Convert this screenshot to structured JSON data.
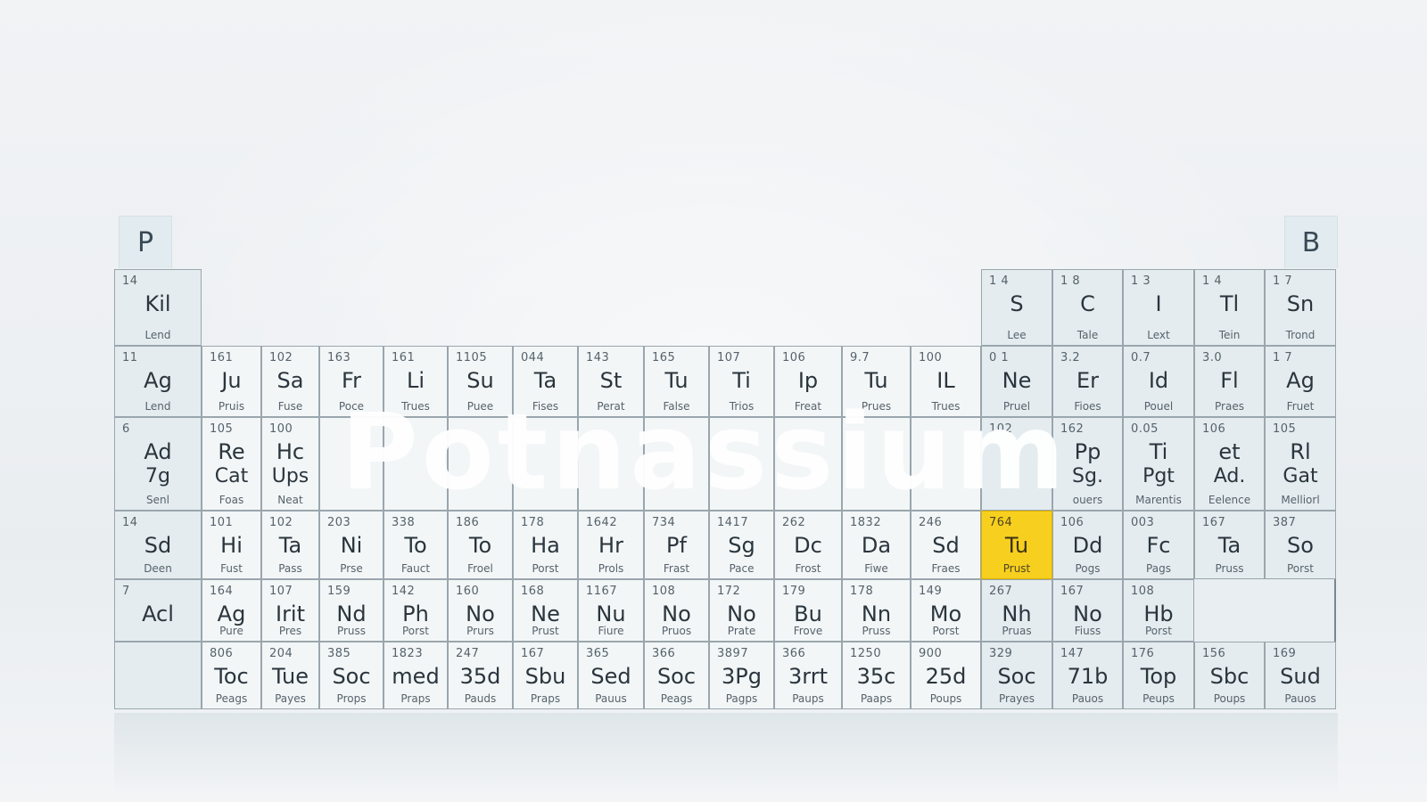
{
  "tabs": {
    "left": "P",
    "right": "B"
  },
  "overlay_text": "Potnassium",
  "highlight_color": "#f7cf1f",
  "cells": [
    {
      "n": "14",
      "s": "Kil",
      "l": "Lend",
      "c": 0,
      "r": 0
    },
    {
      "n": "1 4",
      "s": "S",
      "l": "Lee",
      "c": 13,
      "r": 0
    },
    {
      "n": "1 8",
      "s": "C",
      "l": "Tale",
      "c": 14,
      "r": 0
    },
    {
      "n": "1 3",
      "s": "I",
      "l": "Lext",
      "c": 15,
      "r": 0
    },
    {
      "n": "1 4",
      "s": "Tl",
      "l": "Tein",
      "c": 16,
      "r": 0
    },
    {
      "n": "1 7",
      "s": "Sn",
      "l": "Trond",
      "c": 17,
      "r": 0
    },
    {
      "n": "11",
      "s": "Ag",
      "l": "Lend",
      "c": 0,
      "r": 1
    },
    {
      "n": "161",
      "s": "Ju",
      "l": "Pruis",
      "c": 1,
      "r": 1
    },
    {
      "n": "102",
      "s": "Sa",
      "l": "Fuse",
      "c": 2,
      "r": 1
    },
    {
      "n": "163",
      "s": "Fr",
      "l": "Poce",
      "c": 3,
      "r": 1
    },
    {
      "n": "161",
      "s": "Li",
      "l": "Trues",
      "c": 4,
      "r": 1
    },
    {
      "n": "1105",
      "s": "Su",
      "l": "Puee",
      "c": 5,
      "r": 1
    },
    {
      "n": "044",
      "s": "Ta",
      "l": "Fises",
      "c": 6,
      "r": 1
    },
    {
      "n": "143",
      "s": "St",
      "l": "Perat",
      "c": 7,
      "r": 1
    },
    {
      "n": "165",
      "s": "Tu",
      "l": "False",
      "c": 8,
      "r": 1
    },
    {
      "n": "107",
      "s": "Ti",
      "l": "Trios",
      "c": 9,
      "r": 1
    },
    {
      "n": "106",
      "s": "Ip",
      "l": "Freat",
      "c": 10,
      "r": 1
    },
    {
      "n": "9.7",
      "s": "Tu",
      "l": "Prues",
      "c": 11,
      "r": 1
    },
    {
      "n": "100",
      "s": "IL",
      "l": "Trues",
      "c": 12,
      "r": 1
    },
    {
      "n": "0 1",
      "s": "Ne",
      "l": "Pruel",
      "c": 13,
      "r": 1
    },
    {
      "n": "3.2",
      "s": "Er",
      "l": "Fioes",
      "c": 14,
      "r": 1
    },
    {
      "n": "0.7",
      "s": "Id",
      "l": "Pouel",
      "c": 15,
      "r": 1
    },
    {
      "n": "3.0",
      "s": "Fl",
      "l": "Praes",
      "c": 16,
      "r": 1
    },
    {
      "n": "1 7",
      "s": "Ag",
      "l": "Fruet",
      "c": 17,
      "r": 1
    },
    {
      "n": "6",
      "s": "Ad",
      "s2": "7g",
      "l": "Senl",
      "c": 0,
      "r": 2
    },
    {
      "n": "105",
      "s": "Re",
      "s2": "Cat",
      "l": "Foas",
      "c": 1,
      "r": 2
    },
    {
      "n": "100",
      "s": "Hc",
      "s2": "Ups",
      "l": "Neat",
      "c": 2,
      "r": 2
    },
    {
      "n": "",
      "s": "",
      "l": "",
      "c": 3,
      "r": 2
    },
    {
      "n": "",
      "s": "",
      "l": "",
      "c": 4,
      "r": 2
    },
    {
      "n": "",
      "s": "",
      "l": "",
      "c": 5,
      "r": 2
    },
    {
      "n": "",
      "s": "",
      "l": "",
      "c": 6,
      "r": 2
    },
    {
      "n": "",
      "s": "",
      "l": "",
      "c": 7,
      "r": 2
    },
    {
      "n": "",
      "s": "",
      "l": "",
      "c": 8,
      "r": 2
    },
    {
      "n": "",
      "s": "",
      "l": "",
      "c": 9,
      "r": 2
    },
    {
      "n": "",
      "s": "",
      "l": "",
      "c": 10,
      "r": 2
    },
    {
      "n": "",
      "s": "",
      "l": "",
      "c": 11,
      "r": 2
    },
    {
      "n": "",
      "s": "",
      "l": "",
      "c": 12,
      "r": 2
    },
    {
      "n": "102",
      "s": "",
      "l": "",
      "c": 13,
      "r": 2
    },
    {
      "n": "162",
      "s": "Pp",
      "s2": "Sg.",
      "l": "ouers",
      "c": 14,
      "r": 2
    },
    {
      "n": "0.05",
      "s": "Ti",
      "s2": "Pgt",
      "l": "Marentis",
      "c": 15,
      "r": 2
    },
    {
      "n": "106",
      "s": "et",
      "s2": "Ad.",
      "l": "Eelence",
      "c": 16,
      "r": 2
    },
    {
      "n": "105",
      "s": "Rl",
      "s2": "Gat",
      "l": "Melliorl",
      "c": 17,
      "r": 2
    },
    {
      "n": "14",
      "s": "Sd",
      "l": "Deen",
      "c": 0,
      "r": 3
    },
    {
      "n": "101",
      "s": "Hi",
      "l": "Fust",
      "c": 1,
      "r": 3
    },
    {
      "n": "102",
      "s": "Ta",
      "l": "Pass",
      "c": 2,
      "r": 3
    },
    {
      "n": "203",
      "s": "Ni",
      "l": "Prse",
      "c": 3,
      "r": 3
    },
    {
      "n": "338",
      "s": "To",
      "l": "Fauct",
      "c": 4,
      "r": 3
    },
    {
      "n": "186",
      "s": "To",
      "l": "Froel",
      "c": 5,
      "r": 3
    },
    {
      "n": "178",
      "s": "Ha",
      "l": "Porst",
      "c": 6,
      "r": 3
    },
    {
      "n": "1642",
      "s": "Hr",
      "l": "Prols",
      "c": 7,
      "r": 3
    },
    {
      "n": "734",
      "s": "Pf",
      "l": "Frast",
      "c": 8,
      "r": 3
    },
    {
      "n": "1417",
      "s": "Sg",
      "l": "Pace",
      "c": 9,
      "r": 3
    },
    {
      "n": "262",
      "s": "Dc",
      "l": "Frost",
      "c": 10,
      "r": 3
    },
    {
      "n": "1832",
      "s": "Da",
      "l": "Fiwe",
      "c": 11,
      "r": 3
    },
    {
      "n": "246",
      "s": "Sd",
      "l": "Fraes",
      "c": 12,
      "r": 3
    },
    {
      "n": "764",
      "s": "Tu",
      "l": "Prust",
      "c": 13,
      "r": 3,
      "hl": true
    },
    {
      "n": "106",
      "s": "Dd",
      "l": "Pogs",
      "c": 14,
      "r": 3
    },
    {
      "n": "003",
      "s": "Fc",
      "l": "Pags",
      "c": 15,
      "r": 3
    },
    {
      "n": "167",
      "s": "Ta",
      "l": "Pruss",
      "c": 16,
      "r": 3
    },
    {
      "n": "387",
      "s": "So",
      "l": "Porst",
      "c": 17,
      "r": 3
    },
    {
      "n": "7",
      "s": "Acl",
      "l": "",
      "c": 0,
      "r": 4
    },
    {
      "n": "164",
      "s": "Ag",
      "l": "Pure",
      "c": 1,
      "r": 4
    },
    {
      "n": "107",
      "s": "Irit",
      "l": "Pres",
      "c": 2,
      "r": 4
    },
    {
      "n": "159",
      "s": "Nd",
      "l": "Pruss",
      "c": 3,
      "r": 4
    },
    {
      "n": "142",
      "s": "Ph",
      "l": "Porst",
      "c": 4,
      "r": 4
    },
    {
      "n": "160",
      "s": "No",
      "l": "Prurs",
      "c": 5,
      "r": 4
    },
    {
      "n": "168",
      "s": "Ne",
      "l": "Prust",
      "c": 6,
      "r": 4
    },
    {
      "n": "1167",
      "s": "Nu",
      "l": "Fiure",
      "c": 7,
      "r": 4
    },
    {
      "n": "108",
      "s": "No",
      "l": "Pruos",
      "c": 8,
      "r": 4
    },
    {
      "n": "172",
      "s": "No",
      "l": "Prate",
      "c": 9,
      "r": 4
    },
    {
      "n": "179",
      "s": "Bu",
      "l": "Frove",
      "c": 10,
      "r": 4
    },
    {
      "n": "178",
      "s": "Nn",
      "l": "Pruss",
      "c": 11,
      "r": 4
    },
    {
      "n": "149",
      "s": "Mo",
      "l": "Porst",
      "c": 12,
      "r": 4
    },
    {
      "n": "267",
      "s": "Nh",
      "l": "Pruas",
      "c": 13,
      "r": 4
    },
    {
      "n": "167",
      "s": "No",
      "l": "Fiuss",
      "c": 14,
      "r": 4
    },
    {
      "n": "108",
      "s": "Hb",
      "l": "Porst",
      "c": 15,
      "r": 4
    },
    {
      "n": "806",
      "s": "Toc",
      "l": "Peags",
      "c": 1,
      "r": 5
    },
    {
      "n": "204",
      "s": "Tue",
      "l": "Payes",
      "c": 2,
      "r": 5
    },
    {
      "n": "385",
      "s": "Soc",
      "l": "Props",
      "c": 3,
      "r": 5
    },
    {
      "n": "1823",
      "s": "med",
      "l": "Praps",
      "c": 4,
      "r": 5
    },
    {
      "n": "247",
      "s": "35d",
      "l": "Pauds",
      "c": 5,
      "r": 5
    },
    {
      "n": "167",
      "s": "Sbu",
      "l": "Praps",
      "c": 6,
      "r": 5
    },
    {
      "n": "365",
      "s": "Sed",
      "l": "Pauus",
      "c": 7,
      "r": 5
    },
    {
      "n": "366",
      "s": "Soc",
      "l": "Peags",
      "c": 8,
      "r": 5
    },
    {
      "n": "3897",
      "s": "3Pg",
      "l": "Pagps",
      "c": 9,
      "r": 5
    },
    {
      "n": "366",
      "s": "3rrt",
      "l": "Paups",
      "c": 10,
      "r": 5
    },
    {
      "n": "1250",
      "s": "35c",
      "l": "Paaps",
      "c": 11,
      "r": 5
    },
    {
      "n": "900",
      "s": "25d",
      "l": "Poups",
      "c": 12,
      "r": 5
    },
    {
      "n": "329",
      "s": "Soc",
      "l": "Prayes",
      "c": 13,
      "r": 5
    },
    {
      "n": "147",
      "s": "71b",
      "l": "Pauos",
      "c": 14,
      "r": 5
    },
    {
      "n": "176",
      "s": "Top",
      "l": "Peups",
      "c": 15,
      "r": 5
    },
    {
      "n": "156",
      "s": "Sbc",
      "l": "Poups",
      "c": 16,
      "r": 5
    },
    {
      "n": "169",
      "s": "Sud",
      "l": "Pauos",
      "c": 17,
      "r": 5
    }
  ]
}
